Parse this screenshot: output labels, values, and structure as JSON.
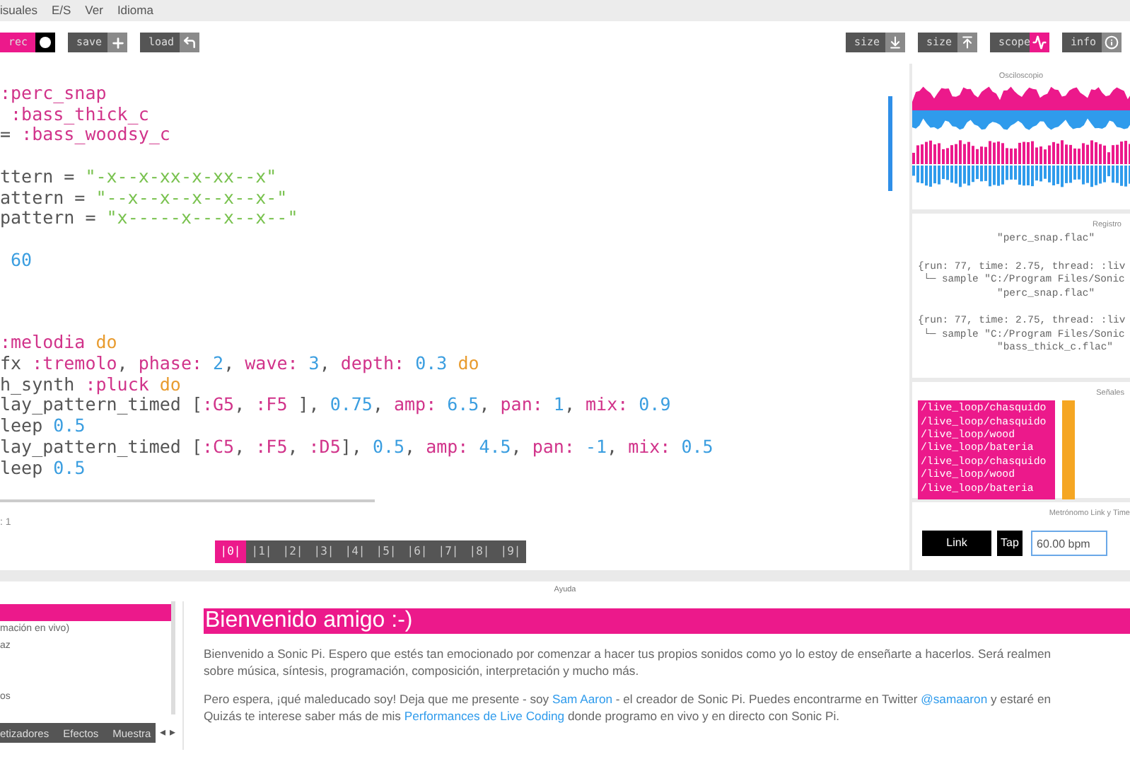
{
  "menu": [
    "isuales",
    "E/S",
    "Ver",
    "Idioma"
  ],
  "toolbar_left": [
    {
      "label": "rec",
      "kind": "record"
    },
    {
      "label": "save",
      "kind": "save"
    },
    {
      "label": "load",
      "kind": "load"
    }
  ],
  "toolbar_right": [
    {
      "label": "size",
      "kind": "size_down",
      "active": false
    },
    {
      "label": "size",
      "kind": "size_up",
      "active": false
    },
    {
      "label": "scope",
      "kind": "scope",
      "active": true
    },
    {
      "label": "info",
      "kind": "info",
      "active": false
    }
  ],
  "code": [
    {
      "lines": [
        [
          {
            "kind": "sym",
            "text": ":perc_snap"
          }
        ],
        [
          {
            "kind": "sym",
            "text": " :bass_thick_c"
          }
        ],
        [
          {
            "kind": "plain",
            "text": "= "
          },
          {
            "kind": "sym",
            "text": ":bass_woodsy_c"
          }
        ]
      ]
    },
    {
      "lines": [
        [
          {
            "kind": "plain",
            "text": "ttern = "
          },
          {
            "kind": "str",
            "text": "\"-x--x-xx-x-xx--x\""
          }
        ],
        [
          {
            "kind": "plain",
            "text": "attern = "
          },
          {
            "kind": "str",
            "text": "\"--x--x--x--x--x-\""
          }
        ],
        [
          {
            "kind": "plain",
            "text": "pattern = "
          },
          {
            "kind": "str",
            "text": "\"x-----x---x--x--\""
          }
        ]
      ]
    },
    {
      "lines": [
        [
          {
            "kind": "num",
            "text": " 60"
          }
        ]
      ]
    },
    {
      "lines": [
        [
          {
            "kind": "sym",
            "text": ":melodia"
          },
          {
            "kind": "kw",
            "text": " do"
          }
        ],
        [
          {
            "kind": "plain",
            "text": "fx "
          },
          {
            "kind": "sym",
            "text": ":tremolo"
          },
          {
            "kind": "plain",
            "text": ", "
          },
          {
            "kind": "sym",
            "text": "phase:"
          },
          {
            "kind": "num",
            "text": " 2"
          },
          {
            "kind": "plain",
            "text": ", "
          },
          {
            "kind": "sym",
            "text": "wave:"
          },
          {
            "kind": "num",
            "text": " 3"
          },
          {
            "kind": "plain",
            "text": ", "
          },
          {
            "kind": "sym",
            "text": "depth:"
          },
          {
            "kind": "num",
            "text": " 0.3"
          },
          {
            "kind": "kw",
            "text": " do"
          }
        ],
        [
          {
            "kind": "plain",
            "text": "h_synth "
          },
          {
            "kind": "sym",
            "text": ":pluck"
          },
          {
            "kind": "kw",
            "text": " do"
          }
        ],
        [
          {
            "kind": "plain",
            "text": "lay_pattern_timed ["
          },
          {
            "kind": "sym",
            "text": ":G5"
          },
          {
            "kind": "plain",
            "text": ", "
          },
          {
            "kind": "sym",
            "text": ":F5"
          },
          {
            "kind": "plain",
            "text": " ], "
          },
          {
            "kind": "num",
            "text": "0.75"
          },
          {
            "kind": "plain",
            "text": ", "
          },
          {
            "kind": "sym",
            "text": "amp:"
          },
          {
            "kind": "num",
            "text": " 6.5"
          },
          {
            "kind": "plain",
            "text": ", "
          },
          {
            "kind": "sym",
            "text": "pan:"
          },
          {
            "kind": "num",
            "text": " 1"
          },
          {
            "kind": "plain",
            "text": ", "
          },
          {
            "kind": "sym",
            "text": "mix:"
          },
          {
            "kind": "num",
            "text": " 0.9"
          }
        ],
        [
          {
            "kind": "plain",
            "text": "leep "
          },
          {
            "kind": "num",
            "text": "0.5"
          }
        ],
        [
          {
            "kind": "plain",
            "text": "lay_pattern_timed ["
          },
          {
            "kind": "sym",
            "text": ":C5"
          },
          {
            "kind": "plain",
            "text": ", "
          },
          {
            "kind": "sym",
            "text": ":F5"
          },
          {
            "kind": "plain",
            "text": ", "
          },
          {
            "kind": "sym",
            "text": ":D5"
          },
          {
            "kind": "plain",
            "text": "], "
          },
          {
            "kind": "num",
            "text": "0.5"
          },
          {
            "kind": "plain",
            "text": ", "
          },
          {
            "kind": "sym",
            "text": "amp:"
          },
          {
            "kind": "num",
            "text": " 4.5"
          },
          {
            "kind": "plain",
            "text": ", "
          },
          {
            "kind": "sym",
            "text": "pan:"
          },
          {
            "kind": "num",
            "text": " -1"
          },
          {
            "kind": "plain",
            "text": ", "
          },
          {
            "kind": "sym",
            "text": "mix:"
          },
          {
            "kind": "num",
            "text": " 0.5"
          }
        ],
        [
          {
            "kind": "plain",
            "text": "leep "
          },
          {
            "kind": "num",
            "text": "0.5"
          }
        ]
      ]
    }
  ],
  "status_text": ": 1",
  "workspaces": [
    {
      "label": "|0|",
      "selected": true
    },
    {
      "label": "|1|",
      "selected": false
    },
    {
      "label": "|2|",
      "selected": false
    },
    {
      "label": "|3|",
      "selected": false
    },
    {
      "label": "|4|",
      "selected": false
    },
    {
      "label": "|5|",
      "selected": false
    },
    {
      "label": "|6|",
      "selected": false
    },
    {
      "label": "|7|",
      "selected": false
    },
    {
      "label": "|8|",
      "selected": false
    },
    {
      "label": "|9|",
      "selected": false
    }
  ],
  "scope": {
    "title": "Osciloscopio"
  },
  "log": {
    "title": "Registro",
    "lines": [
      {
        "kind": "file",
        "text": "\"perc_snap.flac\""
      },
      {
        "kind": "info",
        "text": "{run: 77, time: 2.75, thread: :liv"
      },
      {
        "kind": "sample",
        "text": "└─ sample \"C:/Program Files/Sonic"
      },
      {
        "kind": "file",
        "text": "\"perc_snap.flac\""
      },
      {
        "kind": "info",
        "text": "{run: 77, time: 2.75, thread: :liv"
      },
      {
        "kind": "sample",
        "text": "└─ sample \"C:/Program Files/Sonic"
      },
      {
        "kind": "file",
        "text": "\"bass_thick_c.flac\""
      }
    ]
  },
  "cues": {
    "title": "Señales",
    "items": [
      "/live_loop/chasquido",
      "/live_loop/chasquido",
      "/live_loop/wood",
      "/live_loop/bateria",
      "/live_loop/chasquido",
      "/live_loop/wood",
      "/live_loop/bateria"
    ]
  },
  "metronome": {
    "title": "Metrónomo Link y Time",
    "link": "Link",
    "tap": "Tap",
    "bpm": "60.00 bpm"
  },
  "help": {
    "title": "Ayuda",
    "list": [
      {
        "selected": true
      },
      {
        "label": "mación en vivo)",
        "selected": false
      },
      {
        "label": "az",
        "selected": false
      },
      {
        "label": "os",
        "selected": false
      }
    ],
    "tabs": [
      "etizadores",
      "Efectos",
      "Muestra"
    ],
    "scroll_arrows": [
      "◂",
      "▸"
    ],
    "heading": "Bienvenido amigo :-)",
    "paragraphs": [
      [
        [
          {
            "kind": "text",
            "text": "Bienvenido a Sonic Pi. Espero que estés tan emocionado por comenzar a hacer tus propios sonidos como yo lo estoy de enseñarte a hacerlos. Será realmen"
          }
        ],
        [
          {
            "kind": "text",
            "text": "sobre música, síntesis, programación, composición, interpretación y mucho más."
          }
        ]
      ],
      [
        [
          {
            "kind": "text",
            "text": "Pero espera, ¡qué maleducado soy! Deja que me presente - soy "
          },
          {
            "kind": "link",
            "text": "Sam Aaron"
          },
          {
            "kind": "text",
            "text": " - el creador de Sonic Pi. Puedes encontrarme en Twitter "
          },
          {
            "kind": "link",
            "text": "@samaaron"
          },
          {
            "kind": "text",
            "text": " y estaré en"
          }
        ],
        [
          {
            "kind": "text",
            "text": "Quizás te interese saber más de mis "
          },
          {
            "kind": "link",
            "text": "Performances de Live Coding"
          },
          {
            "kind": "text",
            "text": " donde programo en vivo y en directo con Sonic Pi."
          }
        ]
      ]
    ]
  }
}
